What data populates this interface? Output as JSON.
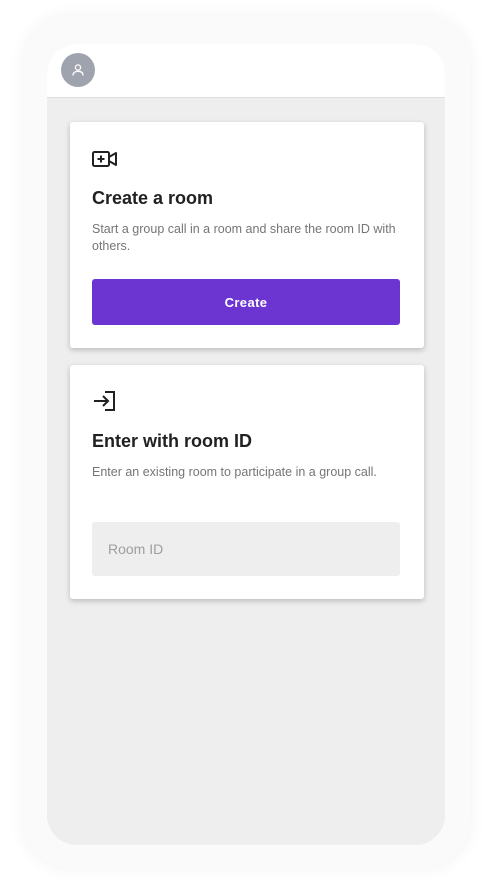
{
  "header": {
    "avatar_icon": "person-icon"
  },
  "create_room": {
    "icon": "video-add-icon",
    "title": "Create a room",
    "description": "Start a group call in a room and share the room ID with others.",
    "button_label": "Create"
  },
  "enter_room": {
    "icon": "login-arrow-icon",
    "title": "Enter with room ID",
    "description": "Enter an existing room to participate in a group call.",
    "input_placeholder": "Room ID",
    "input_value": ""
  },
  "colors": {
    "accent": "#6c35d1",
    "background": "#eeeeee",
    "card": "#ffffff"
  }
}
